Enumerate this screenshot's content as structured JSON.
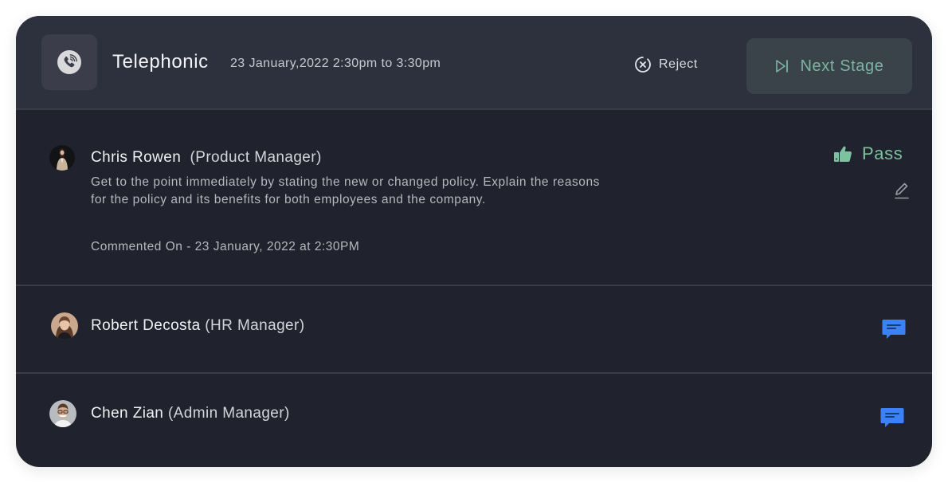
{
  "header": {
    "type_icon": "phone-call-icon",
    "title": "Telephonic",
    "schedule": "23 January,2022 2:30pm to 3:30pm",
    "reject_label": "Reject",
    "reject_icon": "close-circle-icon",
    "next_stage_label": "Next Stage",
    "next_stage_icon": "skip-next-icon"
  },
  "reviewers": [
    {
      "name": "Chris Rowen",
      "role": "(Product Manager)",
      "comment": "Get to the point immediately by stating the new or changed policy. Explain the reasons for the policy and its benefits for both employees and the company.",
      "commented_on": "Commented On - 23 January, 2022 at 2:30PM",
      "status": "Pass",
      "status_icon": "thumbs-up-icon",
      "action_icon": "edit-icon"
    },
    {
      "name": "Robert Decosta",
      "role": "(HR Manager)",
      "action_icon": "chat-icon"
    },
    {
      "name": "Chen Zian",
      "role": "(Admin Manager)",
      "action_icon": "chat-icon"
    }
  ],
  "colors": {
    "card_bg": "#20222d",
    "header_bg": "#2d313d",
    "accent_green": "#7cc2a0",
    "chat_blue": "#3b82f6",
    "next_btn_bg": "#3a434a"
  }
}
